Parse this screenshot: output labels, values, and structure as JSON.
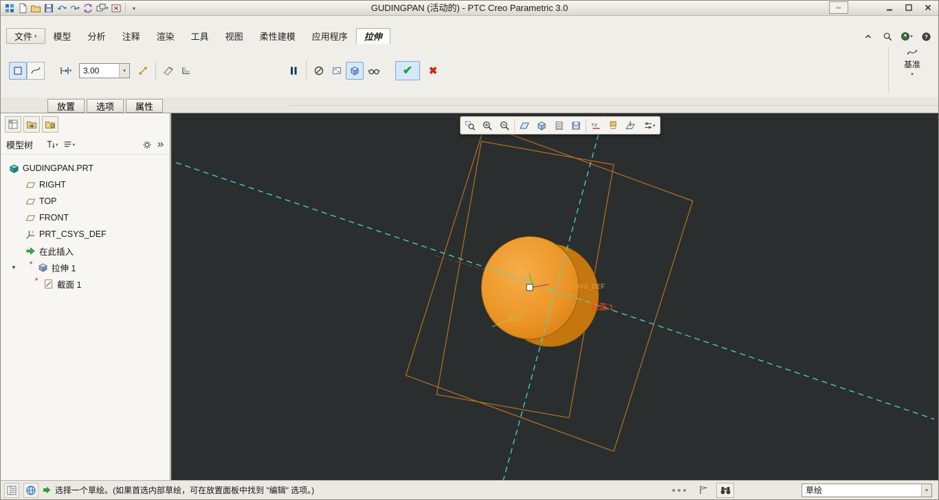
{
  "window": {
    "title": "GUDINGPAN (活动的) - PTC Creo Parametric 3.0"
  },
  "titlebar": {
    "quick_access_icons": [
      "app-grid",
      "new-file",
      "open-file",
      "save",
      "undo",
      "redo",
      "regenerate",
      "window-arrange",
      "close-window",
      "customize-toolbar"
    ],
    "window_control_icons": [
      "fullscreen-toggle",
      "minimize",
      "maximize",
      "close"
    ]
  },
  "ribbon": {
    "tabs": [
      {
        "label": "文件"
      },
      {
        "label": "模型"
      },
      {
        "label": "分析"
      },
      {
        "label": "注释"
      },
      {
        "label": "渲染"
      },
      {
        "label": "工具"
      },
      {
        "label": "视图"
      },
      {
        "label": "柔性建模"
      },
      {
        "label": "应用程序"
      },
      {
        "label": "拉伸"
      }
    ],
    "active_tab": "拉伸",
    "right_icons": [
      "minimize-ribbon",
      "search",
      "presence",
      "help"
    ],
    "dashboard": {
      "depth_value": "3.00",
      "icons": [
        "solid",
        "surface",
        "depth-type",
        "flip-direction",
        "remove-material",
        "thicken-sketch",
        "pause",
        "no-preview",
        "attached-preview",
        "shaded-preview",
        "verify",
        "ok",
        "cancel"
      ],
      "datum_group_label": "基准"
    },
    "panel_tabs": [
      "放置",
      "选项",
      "属性"
    ]
  },
  "model_tree": {
    "title": "模型树",
    "toolbar_icons": [
      "tree-columns",
      "folder-history",
      "folder-settings"
    ],
    "header_icons": [
      "filter",
      "display",
      "settings",
      "panel-options"
    ],
    "items": [
      {
        "label": "GUDINGPAN.PRT",
        "icon": "part"
      },
      {
        "label": "RIGHT",
        "icon": "datum-plane"
      },
      {
        "label": "TOP",
        "icon": "datum-plane"
      },
      {
        "label": "FRONT",
        "icon": "datum-plane"
      },
      {
        "label": "PRT_CSYS_DEF",
        "icon": "csys"
      },
      {
        "label": "在此插入",
        "icon": "insert-here"
      },
      {
        "label": "拉伸 1",
        "icon": "extrude",
        "expanded": true,
        "modified": true
      },
      {
        "label": "截面 1",
        "icon": "sketch",
        "modified": true
      }
    ]
  },
  "graphics": {
    "toolbar_icons": [
      "zoom-region",
      "zoom-in",
      "zoom-out",
      "reorient",
      "display-style",
      "section",
      "capture",
      "measure",
      "annotations",
      "view-normal",
      "view-options"
    ],
    "labels": {
      "csys_label": "PRT_CSYS_DEF",
      "section_label": "截面 1",
      "dimension": "3.00"
    },
    "colors": {
      "background": "#2b2e2e",
      "model_fill": "#ec9526",
      "model_side": "#c4770f",
      "wireframe": "#b57224",
      "centerline": "#43d9d9",
      "section_label_color": "#ff4a12",
      "dimension_color": "#cdb84d"
    }
  },
  "status_bar": {
    "left_icons": [
      "model-tree-toggle",
      "web-browser-toggle"
    ],
    "message": "选择一个草绘。(如果首选内部草绘，可在放置面板中找到 \"编辑\" 选项。)",
    "right_icons": [
      "selection-buffer",
      "flag",
      "find-in-model"
    ],
    "selection_filter": "草绘"
  }
}
